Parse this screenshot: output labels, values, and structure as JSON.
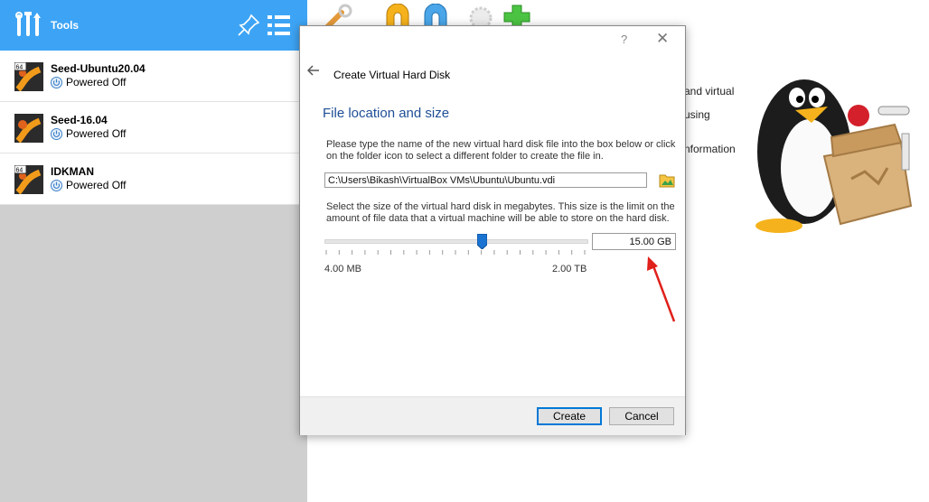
{
  "left_panel": {
    "tools_label": "Tools",
    "vms": [
      {
        "name": "Seed-Ubuntu20.04",
        "status": "Powered Off",
        "badge": "64"
      },
      {
        "name": "Seed-16.04",
        "status": "Powered Off",
        "badge": ""
      },
      {
        "name": "IDKMAN",
        "status": "Powered Off",
        "badge": "64"
      }
    ]
  },
  "background_text": {
    "line1": "and virtual",
    "line2": "using",
    "line3": "nformation"
  },
  "dialog": {
    "help": "?",
    "close": "✕",
    "title": "Create Virtual Hard Disk",
    "section_title": "File location and size",
    "file_instructions": "Please type the name of the new virtual hard disk file into the box below or click on the folder icon to select a different folder to create the file in.",
    "file_path": "C:\\Users\\Bikash\\VirtualBox VMs\\Ubuntu\\Ubuntu.vdi",
    "size_instructions": "Select the size of the virtual hard disk in megabytes. This size is the limit on the amount of file data that a virtual machine will be able to store on the hard disk.",
    "size_value": "15.00 GB",
    "slider_fraction": 0.6,
    "slider_min_label": "4.00 MB",
    "slider_max_label": "2.00 TB",
    "create_label": "Create",
    "cancel_label": "Cancel"
  },
  "colors": {
    "header_blue": "#3da4f5",
    "section_title": "#1f4e96",
    "annotation_red": "#e0201b"
  }
}
